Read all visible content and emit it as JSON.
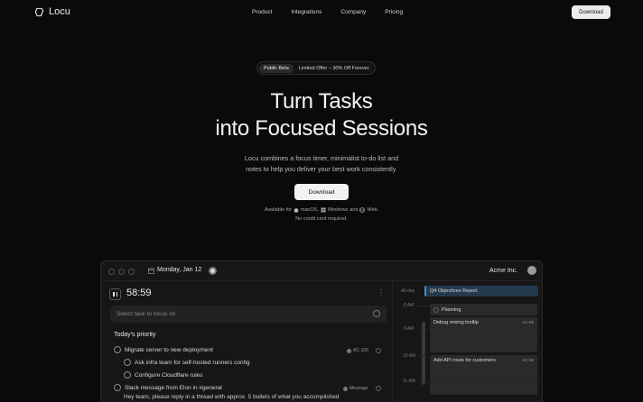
{
  "nav": {
    "logo_text": "Locu",
    "links": [
      "Product",
      "Integrations",
      "Company",
      "Pricing"
    ],
    "download_label": "Download"
  },
  "hero": {
    "pill_tag": "Public Beta",
    "pill_text": "Limited Offer – 30% Off Forever",
    "title_line1": "Turn Tasks",
    "title_line2": "into Focused Sessions",
    "subtitle_line1": "Locu combines a focus timer, minimalist to-do list and",
    "subtitle_line2": "notes to help you deliver your best work consistently.",
    "download_label": "Download",
    "available_for": "Available for",
    "platforms": [
      "macOS,",
      "Windows",
      "and",
      "Web."
    ],
    "no_credit": "No credit card required."
  },
  "app": {
    "date": "Monday, Jan 12",
    "org": "Acme Inc.",
    "timer": "58:59",
    "select_placeholder": "Select task to focus on",
    "section_title": "Today's priority",
    "tasks": [
      {
        "text": "Migrate server to new deployment",
        "badge": "AC-100"
      },
      {
        "text": "Ask infra team for self-hosted runners config"
      },
      {
        "text": "Configure Cloudflare rules"
      },
      {
        "text": "Slack message from Elon in #general",
        "badge": "Message"
      },
      {
        "text": "Hey team, please reply in a thread with approx. 5 bullets of what you accomplished"
      }
    ],
    "calendar": {
      "allday_label": "All-day",
      "hours": [
        "8 AM",
        "9 AM",
        "10 AM",
        "11 AM"
      ],
      "events": [
        {
          "title": "Q4 Objectives Report"
        },
        {
          "title": "Planning"
        },
        {
          "title": "Debug mixing tooltip",
          "code": "AC-88"
        },
        {
          "title": "Add API route for customers",
          "code": "AC-69"
        }
      ]
    }
  },
  "colors": {
    "background": "#0a0a0a",
    "accent_event": "#4a8ad0"
  }
}
